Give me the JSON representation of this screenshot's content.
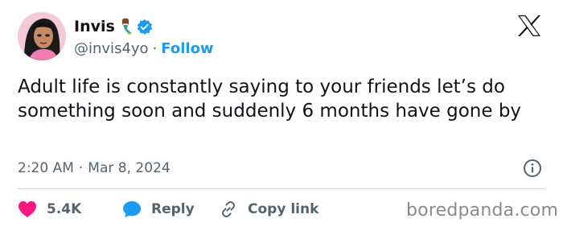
{
  "author": {
    "display_name": "Invis",
    "handle": "@invis4yo",
    "follow_label": "Follow",
    "separator": "·",
    "emoji_icon": "mermaid-emoji-icon",
    "verified_icon": "verified-badge-icon"
  },
  "tweet": {
    "text": "Adult life is constantly saying to your friends let’s do something soon and suddenly 6 months have gone by",
    "time": "2:20 AM",
    "meta_separator": "·",
    "date": "Mar 8, 2024"
  },
  "actions": {
    "likes": "5.4K",
    "reply_label": "Reply",
    "copy_link_label": "Copy link"
  },
  "watermark": "boredpanda.com",
  "colors": {
    "accent": "#1d9bf0",
    "like": "#f91880",
    "text": "#0f1419",
    "muted": "#536471",
    "divider": "#cfd9de"
  }
}
